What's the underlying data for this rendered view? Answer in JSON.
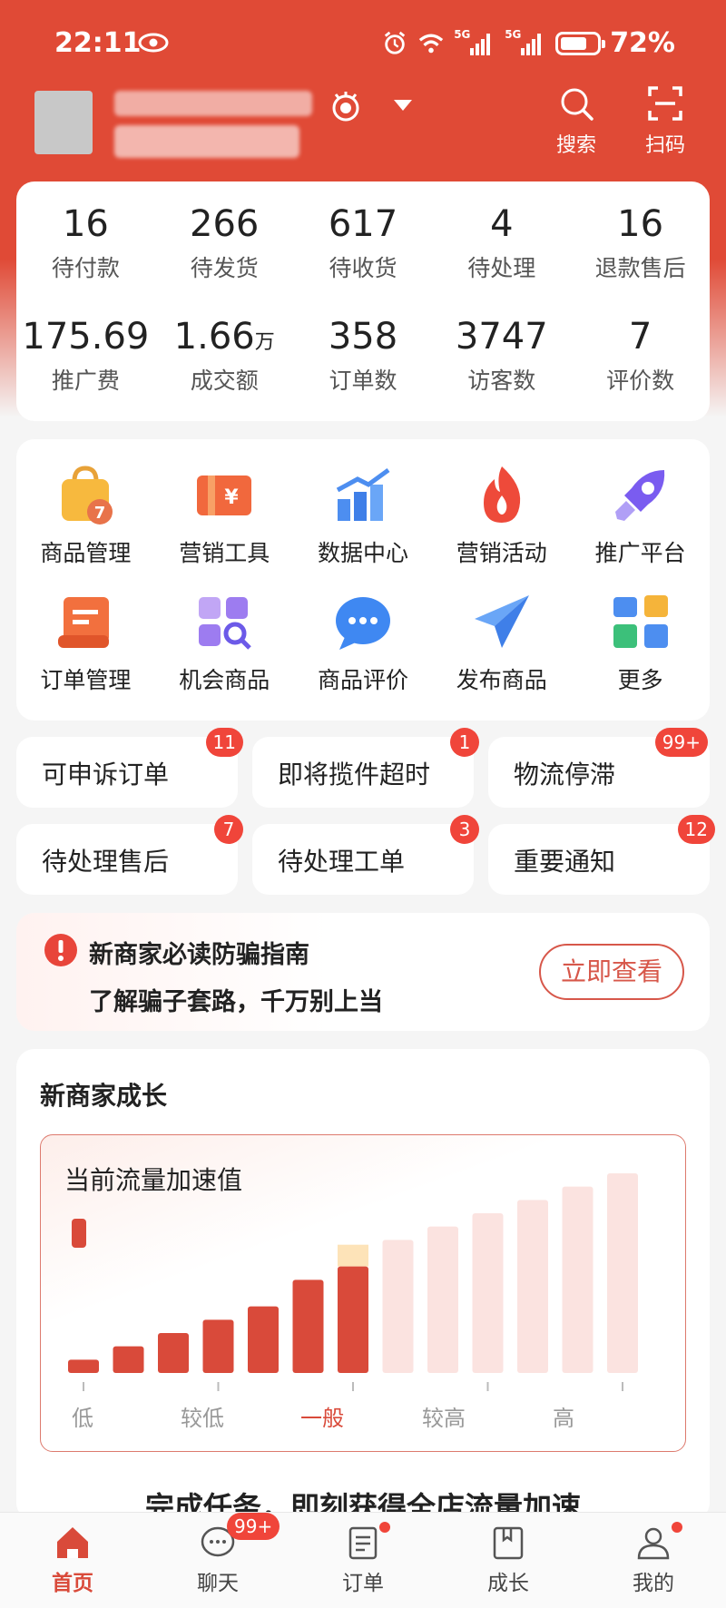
{
  "status_bar": {
    "time": "22:11",
    "battery": "72%",
    "network": "5G"
  },
  "header": {
    "actions": [
      {
        "label": "搜索",
        "icon": "search-icon"
      },
      {
        "label": "扫码",
        "icon": "scan-icon"
      }
    ]
  },
  "stats": {
    "row1": [
      {
        "value": "16",
        "label": "待付款"
      },
      {
        "value": "266",
        "label": "待发货"
      },
      {
        "value": "617",
        "label": "待收货"
      },
      {
        "value": "4",
        "label": "待处理"
      },
      {
        "value": "16",
        "label": "退款售后"
      }
    ],
    "row2": [
      {
        "value": "175.69",
        "label": "推广费"
      },
      {
        "value": "1.66",
        "unit": "万",
        "label": "成交额"
      },
      {
        "value": "358",
        "label": "订单数"
      },
      {
        "value": "3747",
        "label": "访客数"
      },
      {
        "value": "7",
        "label": "评价数"
      }
    ]
  },
  "tools": {
    "row1": [
      {
        "label": "商品管理",
        "icon": "shopping-bag-icon"
      },
      {
        "label": "营销工具",
        "icon": "coupon-icon"
      },
      {
        "label": "数据中心",
        "icon": "bar-chart-icon"
      },
      {
        "label": "营销活动",
        "icon": "flame-icon"
      },
      {
        "label": "推广平台",
        "icon": "rocket-icon"
      }
    ],
    "row2": [
      {
        "label": "订单管理",
        "icon": "scroll-icon"
      },
      {
        "label": "机会商品",
        "icon": "grid-search-icon"
      },
      {
        "label": "商品评价",
        "icon": "chat-bubble-icon"
      },
      {
        "label": "发布商品",
        "icon": "paper-plane-icon"
      },
      {
        "label": "更多",
        "icon": "more-apps-icon"
      }
    ]
  },
  "chips": [
    {
      "label": "可申诉订单",
      "badge": "11"
    },
    {
      "label": "即将揽件超时",
      "badge": "1"
    },
    {
      "label": "物流停滞",
      "badge": "99+"
    },
    {
      "label": "待处理售后",
      "badge": "7"
    },
    {
      "label": "待处理工单",
      "badge": "3"
    },
    {
      "label": "重要通知",
      "badge": "12"
    }
  ],
  "warning": {
    "title": "新商家必读防骗指南",
    "subtitle": "了解骗子套路，千万别上当",
    "button": "立即查看"
  },
  "growth": {
    "title": "新商家成长",
    "footer": "完成任务，即刻获得全店流量加速"
  },
  "chart_data": {
    "type": "bar",
    "title": "当前流量加速值",
    "x_tick_labels": [
      "低",
      "较低",
      "一般",
      "较高",
      "高"
    ],
    "current_level": "一般",
    "values": [
      1,
      2,
      3,
      4,
      5,
      7,
      8,
      10,
      11,
      12,
      13,
      14,
      15
    ],
    "active_count": 7,
    "colors": {
      "active": "#d94a3a",
      "inactive": "#fbe3e0",
      "highlight": "#fde3b8"
    }
  },
  "bottom_nav": [
    {
      "label": "首页",
      "icon": "home-icon",
      "active": true
    },
    {
      "label": "聊天",
      "icon": "chat-icon",
      "badge": "99+"
    },
    {
      "label": "订单",
      "icon": "order-icon",
      "dot": true
    },
    {
      "label": "成长",
      "icon": "bookmark-book-icon"
    },
    {
      "label": "我的",
      "icon": "profile-icon",
      "dot": true
    }
  ]
}
